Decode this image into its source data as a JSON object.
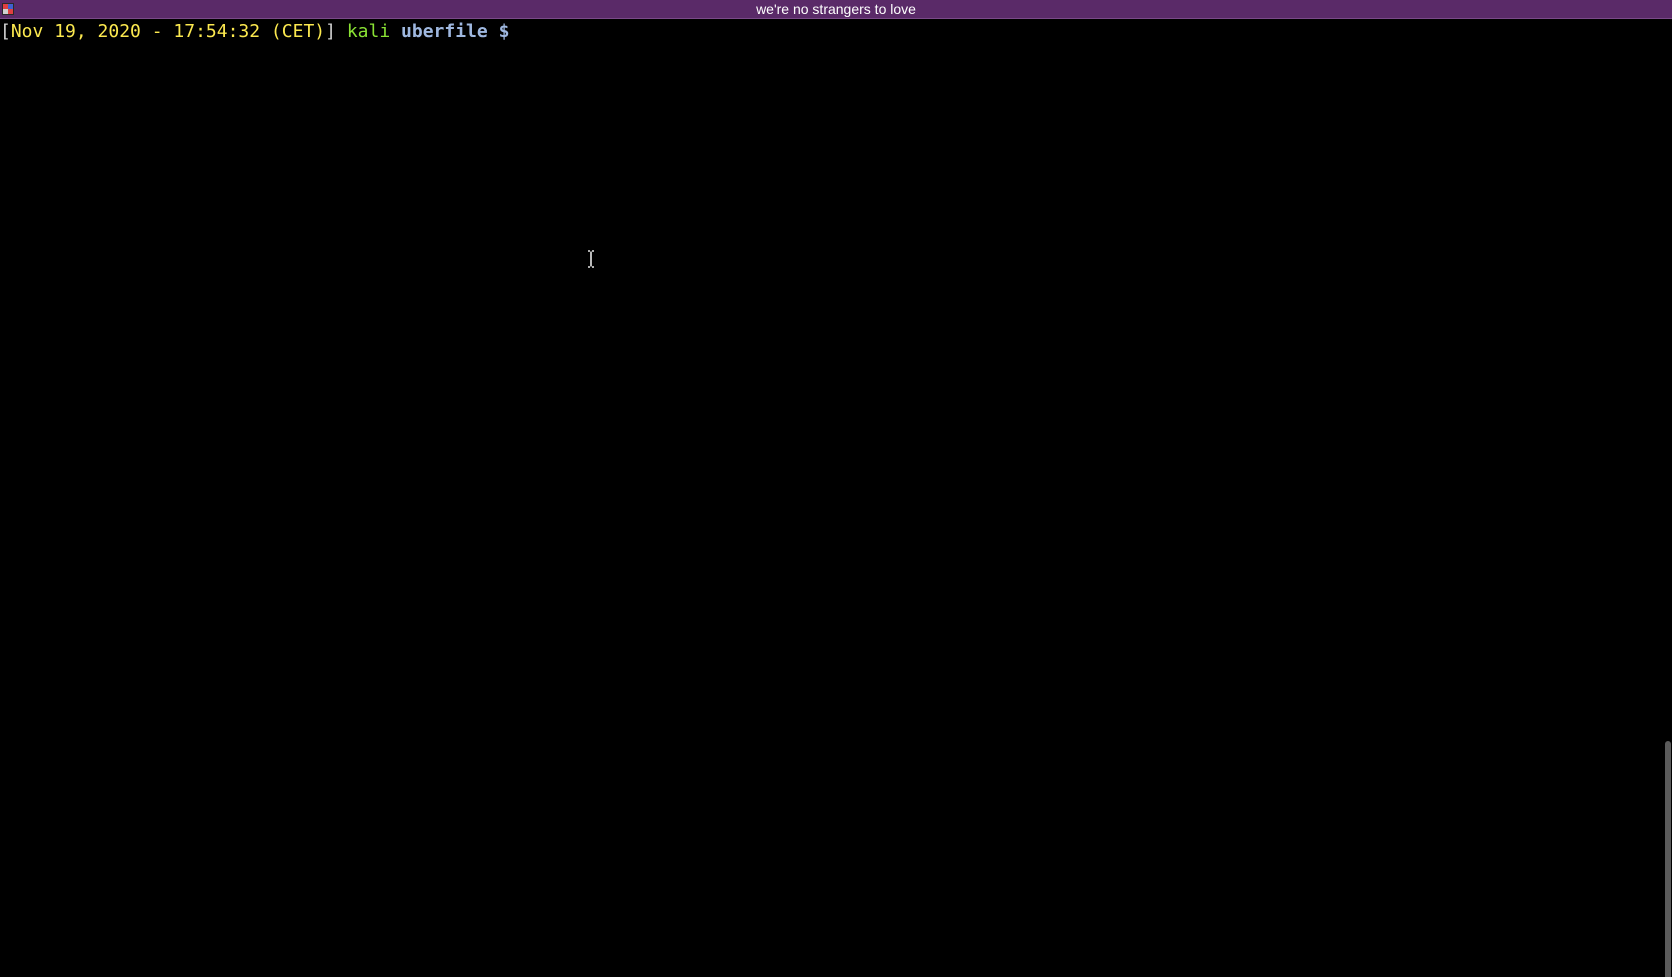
{
  "window": {
    "title": "we're no strangers to love",
    "titlebar_color": "#5a2a68"
  },
  "terminal": {
    "background": "#000000",
    "prompt": {
      "open_bracket": "[",
      "datetime": "Nov 19, 2020 - 17:54:32 (CET)",
      "close_bracket": "]",
      "user": "kali",
      "directory": "uberfile",
      "symbol": "$"
    },
    "colors": {
      "datetime": "#fce94f",
      "user": "#8ae234",
      "directory": "#9fb8e0"
    }
  },
  "icons": {
    "app": "terminal-app-icon",
    "cursor": "text-cursor-icon"
  }
}
